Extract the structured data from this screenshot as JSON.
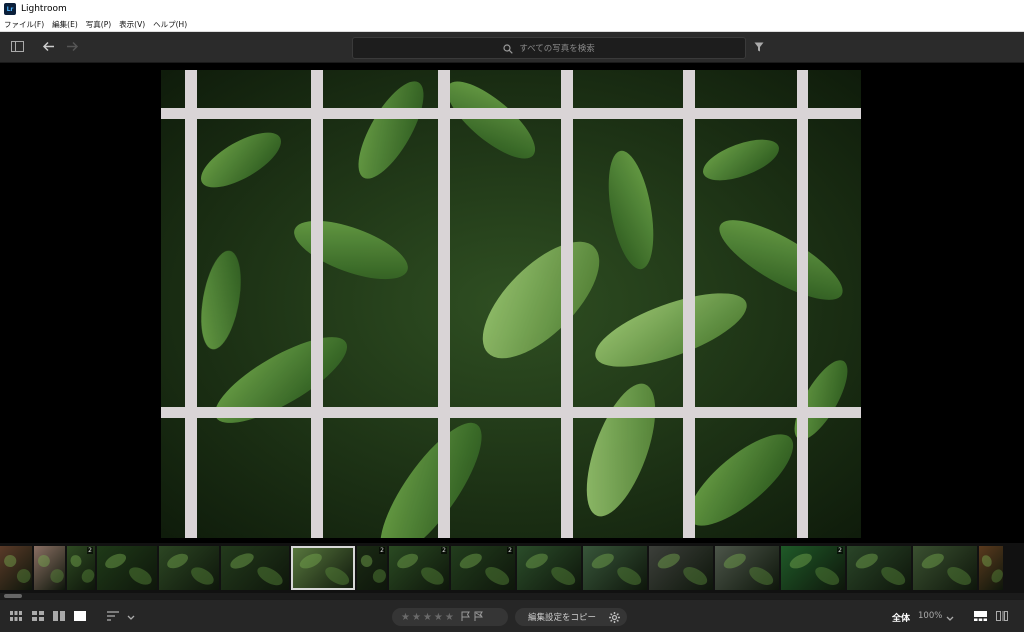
{
  "window": {
    "app_icon_text": "Lr",
    "title": "Lightroom"
  },
  "menu": [
    "ファイル(F)",
    "編集(E)",
    "写真(P)",
    "表示(V)",
    "ヘルプ(H)"
  ],
  "toolbar": {
    "search_placeholder": "すべての写真を検索",
    "icons": [
      "sidebar-toggle-icon",
      "back-arrow-icon",
      "forward-arrow-icon",
      "filter-icon"
    ]
  },
  "viewer": {
    "image_description_icon": "photo-leaves-fence"
  },
  "filmstrip": {
    "thumbnails": [
      {
        "badge": "",
        "tone": "#5a3a28"
      },
      {
        "badge": "",
        "tone": "#8a6f63"
      },
      {
        "badge": "2",
        "tone": "#2e4a22"
      },
      {
        "badge": "",
        "tone": "#1f3a18"
      },
      {
        "badge": "",
        "tone": "#2c4623"
      },
      {
        "badge": "",
        "tone": "#233a1c"
      },
      {
        "badge": "",
        "tone": "#5a7a3f",
        "selected": true
      },
      {
        "badge": "2",
        "tone": "#1a2a14"
      },
      {
        "badge": "2",
        "tone": "#2a4a22"
      },
      {
        "badge": "2",
        "tone": "#223d1d"
      },
      {
        "badge": "",
        "tone": "#2b4d2a"
      },
      {
        "badge": "",
        "tone": "#38563a"
      },
      {
        "badge": "",
        "tone": "#3c3f3a"
      },
      {
        "badge": "",
        "tone": "#4c5549"
      },
      {
        "badge": "2",
        "tone": "#1f5a28"
      },
      {
        "badge": "",
        "tone": "#2a4528"
      },
      {
        "badge": "",
        "tone": "#3a5030"
      },
      {
        "badge": "",
        "tone": "#5a3a1e"
      }
    ]
  },
  "bottombar": {
    "stars": [
      "★",
      "★",
      "★",
      "★",
      "★"
    ],
    "copy_settings_label": "編集設定をコピー",
    "zoom_fit_label": "全体",
    "zoom_percent": "100%"
  },
  "colors": {
    "toolbar_bg": "#2b2b2b",
    "accent_selected": "#d8d8d8"
  }
}
